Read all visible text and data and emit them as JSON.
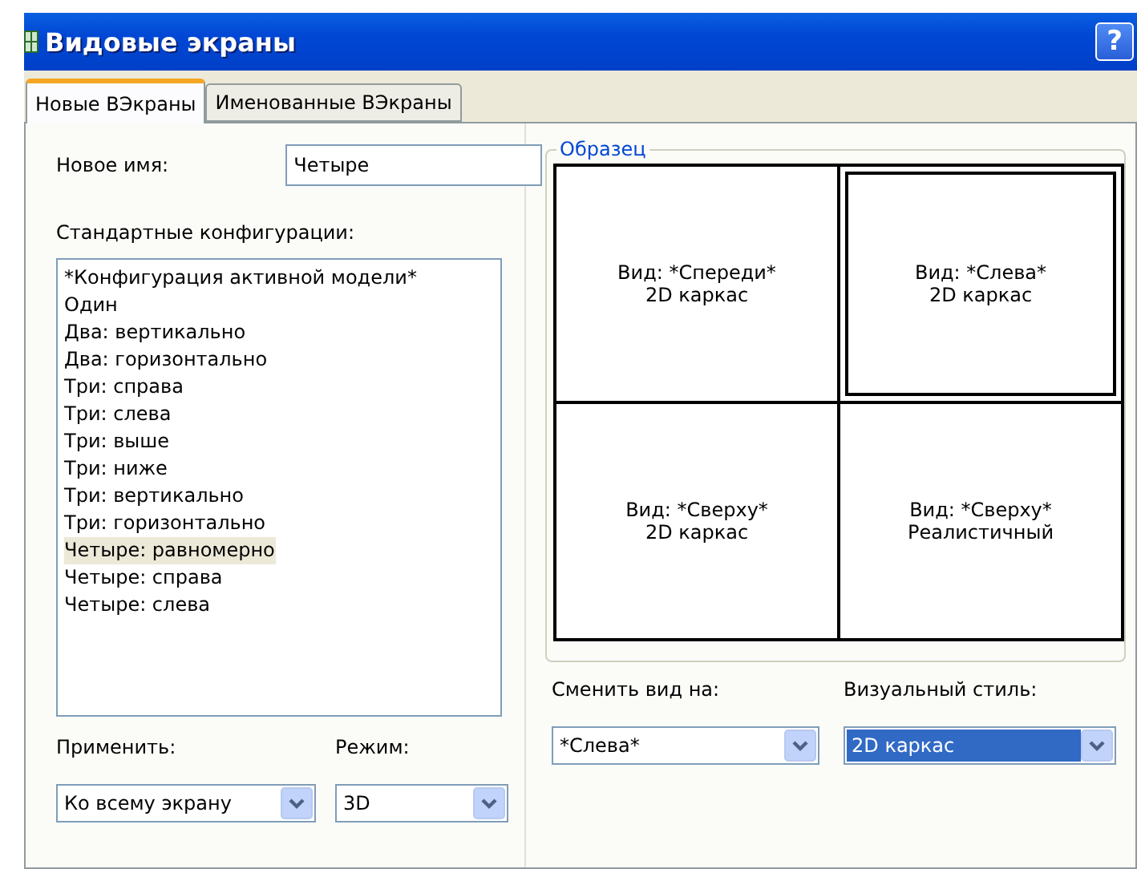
{
  "window": {
    "title": "Видовые экраны",
    "help_button": "?"
  },
  "tabs": [
    {
      "label": "Новые ВЭкраны",
      "selected": true
    },
    {
      "label": "Именованные ВЭкраны",
      "selected": false
    }
  ],
  "new_name": {
    "label": "Новое имя:",
    "value": "Четыре"
  },
  "configurations": {
    "label": "Стандартные конфигурации:",
    "items": [
      {
        "label": "*Конфигурация активной модели*",
        "selected": false
      },
      {
        "label": "Один",
        "selected": false
      },
      {
        "label": "Два: вертикально",
        "selected": false
      },
      {
        "label": "Два: горизонтально",
        "selected": false
      },
      {
        "label": "Три: справа",
        "selected": false
      },
      {
        "label": "Три: слева",
        "selected": false
      },
      {
        "label": "Три: выше",
        "selected": false
      },
      {
        "label": "Три: ниже",
        "selected": false
      },
      {
        "label": "Три: вертикально",
        "selected": false
      },
      {
        "label": "Три: горизонтально",
        "selected": false
      },
      {
        "label": "Четыре: равномерно",
        "selected": true
      },
      {
        "label": "Четыре: справа",
        "selected": false
      },
      {
        "label": "Четыре: слева",
        "selected": false
      }
    ]
  },
  "preview": {
    "title": "Образец",
    "viewports": [
      {
        "view": "Вид: *Спереди*",
        "style": "2D каркас",
        "selected": false
      },
      {
        "view": "Вид: *Слева*",
        "style": "2D каркас",
        "selected": true
      },
      {
        "view": "Вид: *Сверху*",
        "style": "2D каркас",
        "selected": false
      },
      {
        "view": "Вид: *Сверху*",
        "style": "Реалистичный",
        "selected": false
      }
    ]
  },
  "options": [
    {
      "label": "Применить:",
      "value": "Ко всему экрану",
      "highlighted": false
    },
    {
      "label": "Режим:",
      "value": "3D",
      "highlighted": false
    },
    {
      "label": "Сменить вид на:",
      "value": "*Слева*",
      "highlighted": false
    },
    {
      "label": "Визуальный стиль:",
      "value": "2D каркас",
      "highlighted": true
    }
  ]
}
